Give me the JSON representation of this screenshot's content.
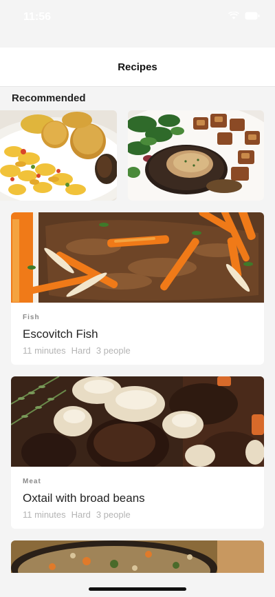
{
  "status_bar": {
    "time": "11:56"
  },
  "nav": {
    "title": "Recipes"
  },
  "recommended": {
    "title": "Recommended"
  },
  "recipes": [
    {
      "category": "Fish",
      "title": "Escovitch Fish",
      "time": "11 minutes",
      "difficulty": "Hard",
      "serves": "3 people"
    },
    {
      "category": "Meat",
      "title": "Oxtail with broad beans",
      "time": "11 minutes",
      "difficulty": "Hard",
      "serves": "3 people"
    }
  ]
}
